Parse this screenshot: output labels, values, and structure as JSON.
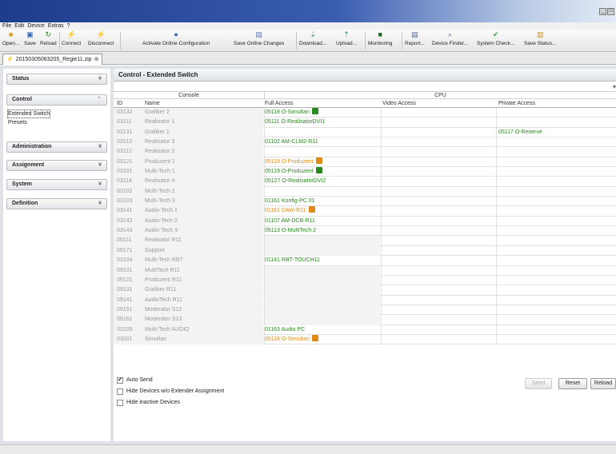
{
  "menu": [
    "File",
    "Edit",
    "Device",
    "Extras",
    "?"
  ],
  "toolbar": {
    "buttons": [
      {
        "label": "Open...",
        "icon": "folder-icon"
      },
      {
        "label": "Save",
        "icon": "save-icon"
      },
      {
        "label": "Reload",
        "icon": "reload-icon"
      },
      {
        "label": "Connect",
        "icon": "connect-icon"
      },
      {
        "label": "Disconnect",
        "icon": "disconnect-icon"
      },
      {
        "label": "Activate Online Configuration",
        "icon": "activate-icon"
      },
      {
        "label": "Save Online Changes",
        "icon": "save-online-icon"
      },
      {
        "label": "Download...",
        "icon": "download-icon"
      },
      {
        "label": "Upload...",
        "icon": "upload-icon"
      },
      {
        "label": "Monitoring",
        "icon": "monitor-icon"
      },
      {
        "label": "Report...",
        "icon": "report-icon"
      },
      {
        "label": "Device Finder...",
        "icon": "device-finder-icon"
      },
      {
        "label": "System Check...",
        "icon": "check-icon"
      },
      {
        "label": "Save Status...",
        "icon": "save-status-icon"
      }
    ]
  },
  "file_tab": {
    "label": "20150305083205_Regie11.zip"
  },
  "sidebar": {
    "sections": [
      {
        "label": "Status",
        "expanded": false
      },
      {
        "label": "Control",
        "expanded": true,
        "items": [
          "Extended Switch",
          "Presets"
        ],
        "selected": "Extended Switch"
      },
      {
        "label": "Administration",
        "expanded": false
      },
      {
        "label": "Assignment",
        "expanded": false
      },
      {
        "label": "System",
        "expanded": false
      },
      {
        "label": "Definition",
        "expanded": false
      }
    ]
  },
  "panel": {
    "title": "Control - Extended Switch"
  },
  "table": {
    "groups": {
      "console": "Console",
      "cpu": "CPU"
    },
    "columns": {
      "id": "ID",
      "name": "Name",
      "full": "Full Access",
      "video": "Video Access",
      "private": "Private Access"
    },
    "colors": {
      "green": "#2a8a1e",
      "orange": "#e08a16"
    },
    "rows": [
      {
        "id": "03132",
        "name": "Grafiker 2",
        "full": "05118  O-Simultan",
        "full_color": "green",
        "full_badge": "green",
        "private": ""
      },
      {
        "id": "03111",
        "name": "Realisator 1",
        "full": "05111  O-RealisatorDVI1",
        "full_color": "green",
        "full_badge": "",
        "private": ""
      },
      {
        "id": "03131",
        "name": "Grafiker 1",
        "full": "",
        "full_color": "",
        "full_badge": "",
        "private": "05117  O-Reserve"
      },
      {
        "id": "03113",
        "name": "Realisator 3",
        "full": "01102  AM-CLM2-R11",
        "full_color": "green",
        "full_badge": "",
        "private": ""
      },
      {
        "id": "03112",
        "name": "Realisator 2",
        "full": "",
        "full_color": "",
        "full_badge": "",
        "private": ""
      },
      {
        "id": "03121",
        "name": "Produzent 1",
        "full": "05119  O-Produzent",
        "full_color": "orange",
        "full_badge": "orange",
        "private": ""
      },
      {
        "id": "03101",
        "name": "Multi-Tech 1",
        "full": "05119  O-Produzent",
        "full_color": "green",
        "full_badge": "green",
        "private": ""
      },
      {
        "id": "03114",
        "name": "Realisator 4",
        "full": "05127  O-RealisatorDVI2",
        "full_color": "green",
        "full_badge": "",
        "private": ""
      },
      {
        "id": "03102",
        "name": "Multi-Tech 2",
        "full": "",
        "full_color": "",
        "full_badge": "",
        "private": ""
      },
      {
        "id": "03103",
        "name": "Multi-Tech 3",
        "full": "01161  Konfig-PC 01",
        "full_color": "green",
        "full_badge": "",
        "private": ""
      },
      {
        "id": "03141",
        "name": "Audio-Tech 1",
        "full": "01161  DAW-R11",
        "full_color": "orange",
        "full_badge": "orange",
        "private": ""
      },
      {
        "id": "03142",
        "name": "Audio-Tech 2",
        "full": "01107  AM-DCB-R11",
        "full_color": "green",
        "full_badge": "",
        "private": ""
      },
      {
        "id": "03143",
        "name": "Audio-Tech 3",
        "full": "05113  O-MultiTech 2",
        "full_color": "green",
        "full_badge": "",
        "private": ""
      },
      {
        "id": "09111",
        "name": "Realisator R11",
        "full": "",
        "full_color": "",
        "full_badge": "",
        "private": "",
        "grey": true
      },
      {
        "id": "09171",
        "name": "Support",
        "full": "",
        "full_color": "",
        "full_badge": "",
        "private": "",
        "grey": true
      },
      {
        "id": "03104",
        "name": "Multi-Tech RBT",
        "full": "01141  RBT-TOUCH11",
        "full_color": "green",
        "full_badge": "",
        "private": ""
      },
      {
        "id": "09101",
        "name": "MultiTech R11",
        "full": "",
        "full_color": "",
        "full_badge": "",
        "private": "",
        "grey": true
      },
      {
        "id": "09121",
        "name": "Produzent R11",
        "full": "",
        "full_color": "",
        "full_badge": "",
        "private": "",
        "grey": true
      },
      {
        "id": "09131",
        "name": "Grafiker R11",
        "full": "",
        "full_color": "",
        "full_badge": "",
        "private": "",
        "grey": true
      },
      {
        "id": "09141",
        "name": "AudioTech R11",
        "full": "",
        "full_color": "",
        "full_badge": "",
        "private": "",
        "grey": true
      },
      {
        "id": "09151",
        "name": "Moderator S12",
        "full": "",
        "full_color": "",
        "full_badge": "",
        "private": "",
        "grey": true
      },
      {
        "id": "09161",
        "name": "Moderator S13",
        "full": "",
        "full_color": "",
        "full_badge": "",
        "private": "",
        "grey": true
      },
      {
        "id": "03105",
        "name": "Multi-Tech AUDIO",
        "full": "01163  Audio PC",
        "full_color": "green",
        "full_badge": "",
        "private": ""
      },
      {
        "id": "03001",
        "name": "Simultan",
        "full": "05118  O-Simultan",
        "full_color": "orange",
        "full_badge": "orange",
        "private": ""
      }
    ]
  },
  "options": {
    "auto_send": {
      "label": "Auto Send",
      "checked": true
    },
    "hide_no_ext": {
      "label": "Hide Devices w/o Extender Assignment",
      "checked": false
    },
    "hide_inactive": {
      "label": "Hide inactive Devices",
      "checked": false
    }
  },
  "buttons": {
    "send": "Send",
    "reset": "Reset",
    "reload": "Reload"
  }
}
